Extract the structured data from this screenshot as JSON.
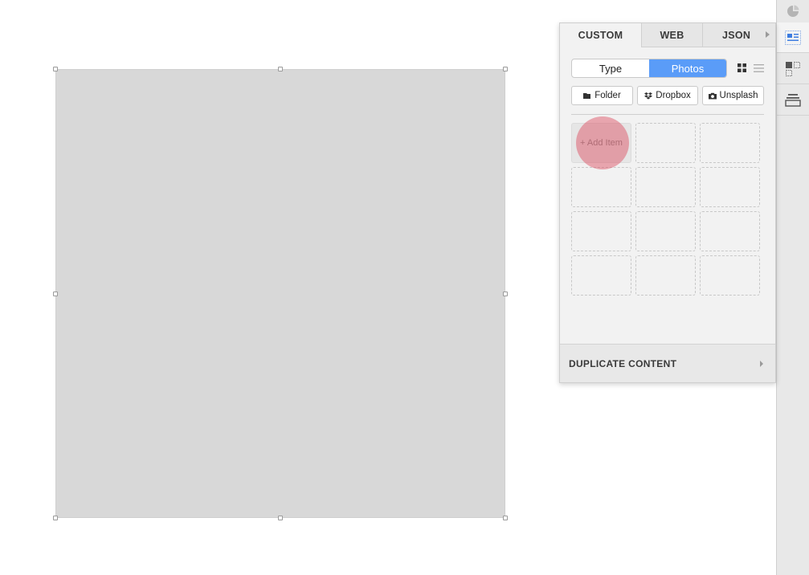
{
  "panel": {
    "tabs": [
      {
        "label": "CUSTOM"
      },
      {
        "label": "WEB"
      },
      {
        "label": "JSON"
      }
    ],
    "segmented": {
      "type_label": "Type",
      "photos_label": "Photos",
      "selected": "Photos"
    },
    "sources": [
      {
        "label": "Folder",
        "icon": "folder-icon"
      },
      {
        "label": "Dropbox",
        "icon": "dropbox-icon"
      },
      {
        "label": "Unsplash",
        "icon": "camera-icon"
      }
    ],
    "add_item_label": "+ Add Item",
    "footer_label": "DUPLICATE CONTENT"
  },
  "toolbar": {
    "icons": [
      "pie-chart-icon",
      "data-panel-icon",
      "grid-layout-icon",
      "stack-icon"
    ],
    "active": "data-panel-icon"
  },
  "colors": {
    "accent": "#5a9cf8",
    "canvas_shape": "#d8d8d8",
    "panel_bg": "#f2f2f2",
    "pointer": "#dc465a"
  }
}
